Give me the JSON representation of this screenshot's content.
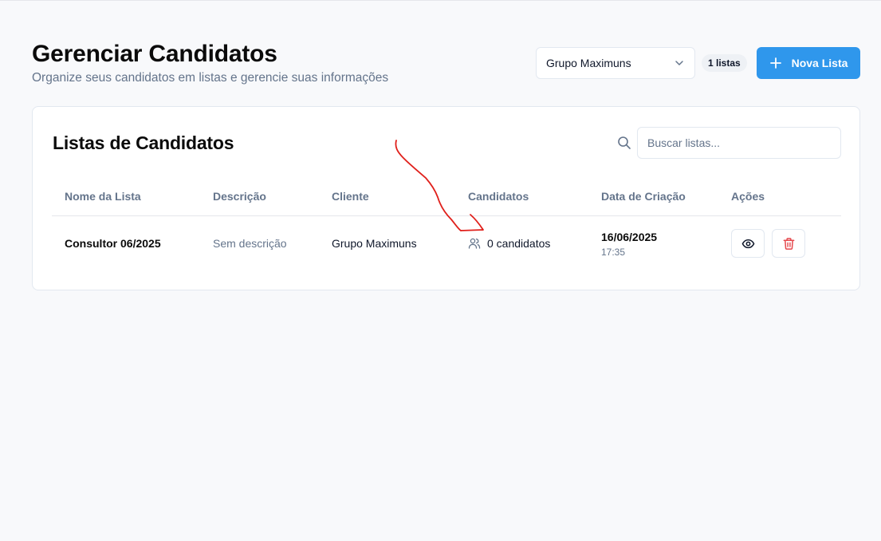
{
  "header": {
    "title": "Gerenciar Candidatos",
    "subtitle": "Organize seus candidatos em listas e gerencie suas informações",
    "client_select_value": "Grupo Maximuns",
    "list_count_badge": "1 listas",
    "new_list_label": "Nova Lista"
  },
  "card": {
    "title": "Listas de Candidatos",
    "search_placeholder": "Buscar listas...",
    "columns": [
      "Nome da Lista",
      "Descrição",
      "Cliente",
      "Candidatos",
      "Data de Criação",
      "Ações"
    ],
    "rows": [
      {
        "name": "Consultor 06/2025",
        "description": "Sem descrição",
        "client": "Grupo Maximuns",
        "candidates": "0 candidatos",
        "date": "16/06/2025",
        "time": "17:35"
      }
    ]
  },
  "icons": {
    "select_chevron": "chevron-down-icon",
    "new_list": "plus-icon",
    "search": "search-icon",
    "candidates": "users-icon",
    "view": "eye-icon",
    "delete": "trash-icon"
  },
  "colors": {
    "primary": "#2f97ec",
    "danger": "#e5484d",
    "annotation": "#e0201b"
  }
}
